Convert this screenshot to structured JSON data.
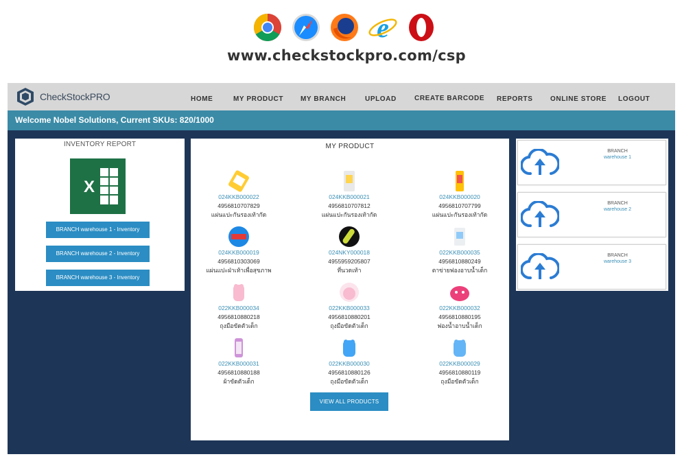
{
  "banner": {
    "browsers": [
      "chrome-icon",
      "safari-icon",
      "firefox-icon",
      "ie-icon",
      "opera-icon"
    ],
    "url": "www.checkstockpro.com/csp"
  },
  "nav": {
    "brand": "CheckStockPRO",
    "items": [
      "HOME",
      "MY PRODUCT",
      "MY BRANCH",
      "UPLOAD",
      "CREATE BARCODE",
      "REPORTS",
      "ONLINE STORE",
      "LOGOUT"
    ]
  },
  "welcome": "Welcome Nobel Solutions, Current SKUs: 820/1000",
  "inventory": {
    "title": "INVENTORY REPORT",
    "buttons": [
      "BRANCH warehouse 1 - Inventory",
      "BRANCH warehouse 2 - Inventory",
      "BRANCH warehouse 3 - Inventory"
    ]
  },
  "products": {
    "title": "MY PRODUCT",
    "items": [
      {
        "code": "024KKB000022",
        "barcode": "4956810707829",
        "name": "แผ่นแปะกันรองเท้ากัด"
      },
      {
        "code": "024KKB000021",
        "barcode": "4956810707812",
        "name": "แผ่นแปะกันรองเท้ากัด"
      },
      {
        "code": "024KKB000020",
        "barcode": "4956810707799",
        "name": "แผ่นแปะกันรองเท้ากัด"
      },
      {
        "code": "024KKB000019",
        "barcode": "4956810303069",
        "name": "แผ่นแปะฝ่าเท้าเพื่อสุขภาพ"
      },
      {
        "code": "024NKY000018",
        "barcode": "4955959205807",
        "name": "ที่นวดเท้า"
      },
      {
        "code": "022KKB000035",
        "barcode": "4956810880249",
        "name": "ตาข่ายฟองอาบน้ำเด็ก"
      },
      {
        "code": "022KKB000034",
        "barcode": "4956810880218",
        "name": "ถุงมือขัดตัวเด็ก"
      },
      {
        "code": "022KKB000033",
        "barcode": "4956810880201",
        "name": "ถุงมือขัดตัวเด็ก"
      },
      {
        "code": "022KKB000032",
        "barcode": "4956810880195",
        "name": "ฟองน้ำอาบน้ำเด็ก"
      },
      {
        "code": "022KKB000031",
        "barcode": "4956810880188",
        "name": "ผ้าขัดตัวเด็ก"
      },
      {
        "code": "022KKB000030",
        "barcode": "4956810880126",
        "name": "ถุงมือขัดตัวเด็ก"
      },
      {
        "code": "022KKB000029",
        "barcode": "4956810880119",
        "name": "ถุงมือขัดตัวเด็ก"
      }
    ],
    "view_all": "VIEW ALL PRODUCTS"
  },
  "branches": [
    {
      "label": "BRANCH",
      "name": "warehouse 1"
    },
    {
      "label": "BRANCH",
      "name": "warehouse 2"
    },
    {
      "label": "BRANCH",
      "name": "warehouse 3"
    }
  ],
  "colors": {
    "accent": "#2b8dc3",
    "welcome_bar": "#3b8ba6",
    "background": "#1d3557",
    "navbar": "#d7d7d7",
    "excel": "#1e7145"
  }
}
